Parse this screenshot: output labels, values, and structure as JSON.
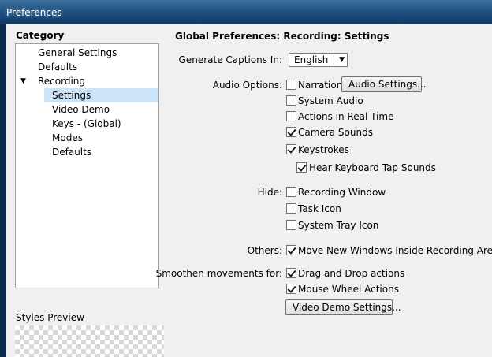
{
  "window": {
    "title": "Preferences"
  },
  "left": {
    "category_label": "Category",
    "tree": [
      {
        "label": "General Settings"
      },
      {
        "label": "Defaults"
      },
      {
        "label": "Recording",
        "expander": "▼"
      },
      {
        "label": "Settings",
        "selected": true
      },
      {
        "label": "Video Demo"
      },
      {
        "label": "Keys - (Global)"
      },
      {
        "label": "Modes"
      },
      {
        "label": "Defaults"
      }
    ],
    "styles_preview_label": "Styles Preview"
  },
  "right": {
    "heading": "Global Preferences: Recording: Settings",
    "captions": {
      "label": "Generate Captions In:",
      "value": "English",
      "arrow": "▼"
    },
    "audio": {
      "label": "Audio Options:",
      "narration": {
        "label": "Narration",
        "checked": false
      },
      "audio_settings_button": "Audio Settings...",
      "system_audio": {
        "label": "System Audio",
        "checked": false
      },
      "actions_real_time": {
        "label": "Actions in Real Time",
        "checked": false
      },
      "camera_sounds": {
        "label": "Camera Sounds",
        "checked": true
      },
      "keystrokes": {
        "label": "Keystrokes",
        "checked": true
      },
      "hear_keyboard": {
        "label": "Hear Keyboard Tap Sounds",
        "checked": true
      }
    },
    "hide": {
      "label": "Hide:",
      "recording_window": {
        "label": "Recording Window",
        "checked": false
      },
      "task_icon": {
        "label": "Task Icon",
        "checked": false
      },
      "system_tray_icon": {
        "label": "System Tray Icon",
        "checked": false
      }
    },
    "others": {
      "label": "Others:",
      "move_windows": {
        "label": "Move New Windows Inside Recording Area",
        "checked": true
      }
    },
    "smoothen": {
      "label": "Smoothen movements for:",
      "drag_drop": {
        "label": "Drag and Drop actions",
        "checked": true
      },
      "mouse_wheel": {
        "label": "Mouse Wheel Actions",
        "checked": true
      },
      "video_demo_settings_button": "Video Demo Settings..."
    }
  }
}
